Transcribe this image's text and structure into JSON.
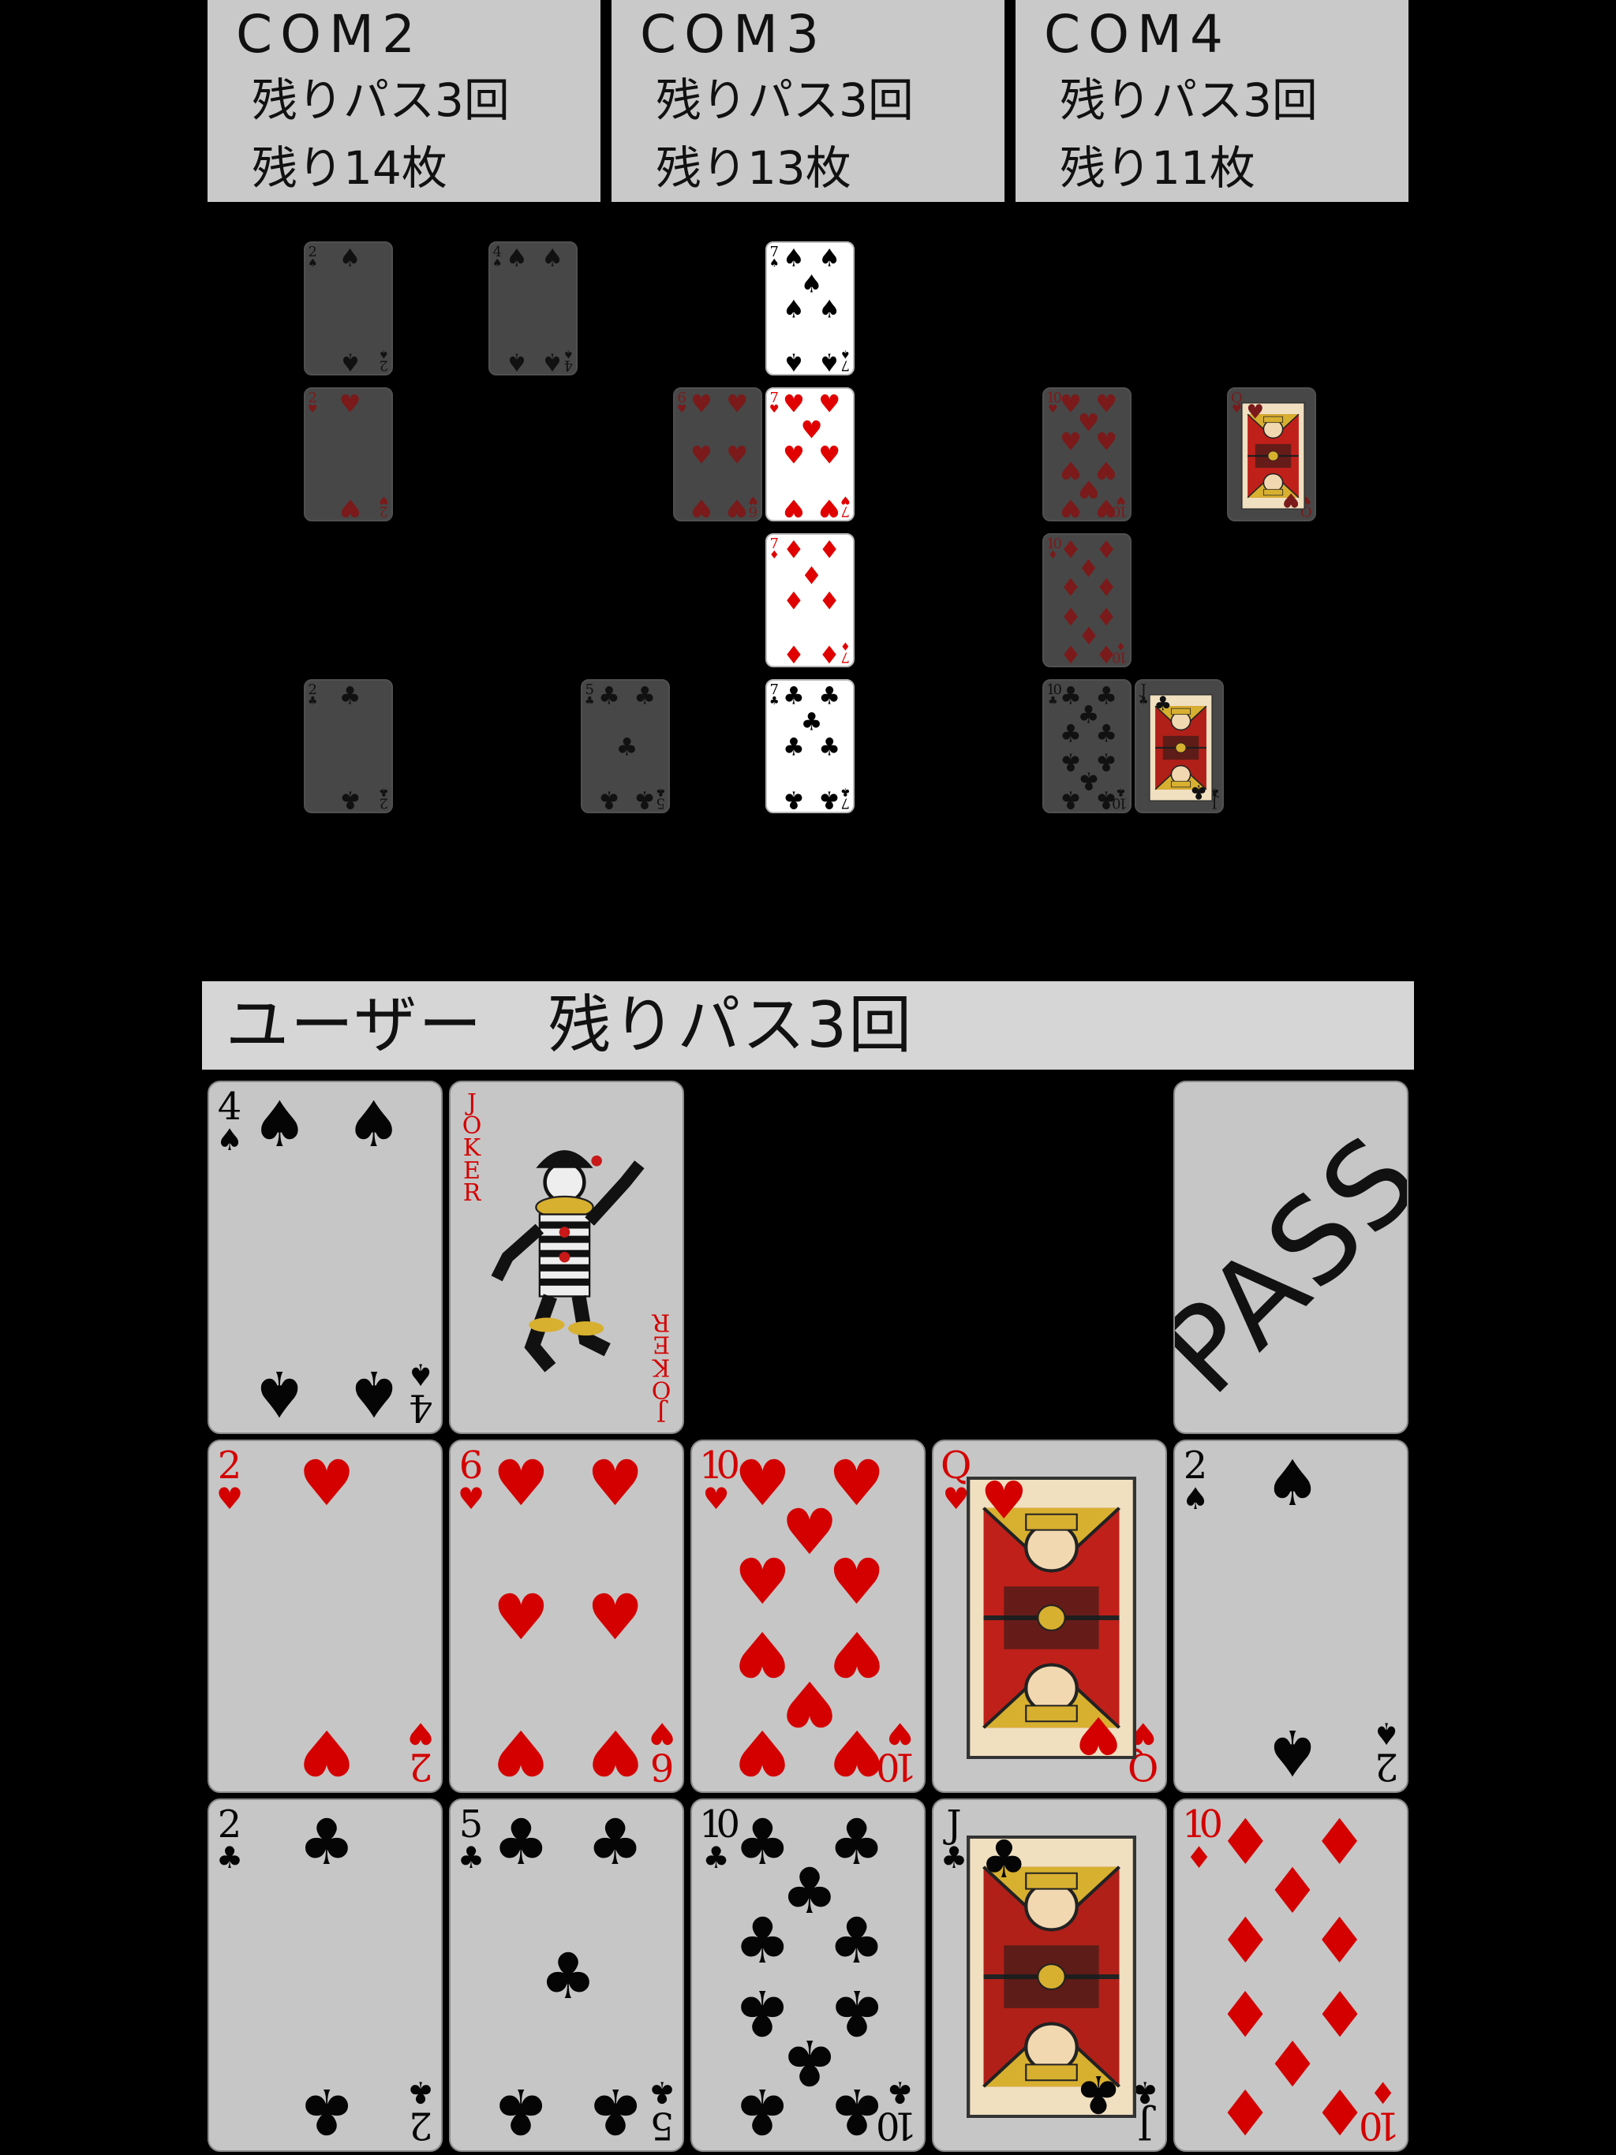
{
  "opponents": [
    {
      "name": "COM2",
      "pass_text": "残りパス3回",
      "count_text": "残り14枚"
    },
    {
      "name": "COM3",
      "pass_text": "残りパス3回",
      "count_text": "残り13枚"
    },
    {
      "name": "COM4",
      "pass_text": "残りパス3回",
      "count_text": "残り11枚"
    }
  ],
  "board": {
    "rows": [
      {
        "suit": "spade",
        "cards": [
          {
            "rank": "2",
            "state": "dim"
          },
          {
            "rank": "4",
            "state": "dim"
          },
          {
            "rank": "7",
            "state": "active"
          }
        ]
      },
      {
        "suit": "heart",
        "cards": [
          {
            "rank": "2",
            "state": "dim"
          },
          {
            "rank": "6",
            "state": "dim"
          },
          {
            "rank": "7",
            "state": "active"
          },
          {
            "rank": "10",
            "state": "dim"
          },
          {
            "rank": "Q",
            "state": "dim"
          }
        ]
      },
      {
        "suit": "diamond",
        "cards": [
          {
            "rank": "7",
            "state": "active"
          },
          {
            "rank": "10",
            "state": "dim"
          }
        ]
      },
      {
        "suit": "club",
        "cards": [
          {
            "rank": "2",
            "state": "dim"
          },
          {
            "rank": "5",
            "state": "dim"
          },
          {
            "rank": "7",
            "state": "active"
          },
          {
            "rank": "10",
            "state": "dim"
          },
          {
            "rank": "J",
            "state": "dim"
          }
        ]
      }
    ]
  },
  "user": {
    "label": "ユーザー　残りパス3回",
    "pass_button": "PASS",
    "joker_index": "JOKER",
    "hand": [
      {
        "rank": "4",
        "suit": "spade"
      },
      {
        "rank": "JOKER",
        "suit": "joker"
      },
      {
        "rank": "2",
        "suit": "heart"
      },
      {
        "rank": "6",
        "suit": "heart"
      },
      {
        "rank": "10",
        "suit": "heart"
      },
      {
        "rank": "Q",
        "suit": "heart"
      },
      {
        "rank": "2",
        "suit": "spade"
      },
      {
        "rank": "2",
        "suit": "club"
      },
      {
        "rank": "5",
        "suit": "club"
      },
      {
        "rank": "10",
        "suit": "club"
      },
      {
        "rank": "J",
        "suit": "club"
      },
      {
        "rank": "10",
        "suit": "diamond"
      }
    ]
  },
  "colors": {
    "background": "#000000",
    "panel": "#c9c9c9",
    "user_bar": "#d6d6d6",
    "card_active": "#ffffff",
    "card_dim": "#474747",
    "hand_card": "#c6c6c6",
    "suit_red": "#e00000",
    "suit_black": "#000000"
  }
}
